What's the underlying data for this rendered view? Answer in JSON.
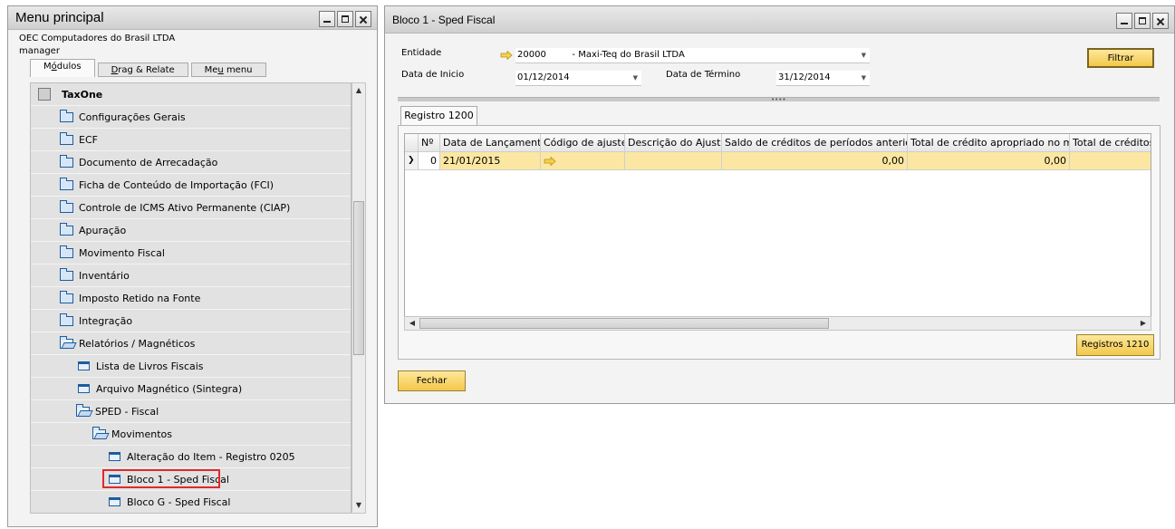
{
  "menu": {
    "title": "Menu principal",
    "company": "OEC Computadores do Brasil LTDA",
    "user": "manager",
    "tabs": [
      {
        "pre": "M",
        "ul": "ó",
        "post": "dulos"
      },
      {
        "pre": "",
        "ul": "D",
        "post": "rag & Relate"
      },
      {
        "pre": "Me",
        "ul": "u",
        "post": " menu"
      }
    ],
    "tree": [
      {
        "label": "TaxOne",
        "icon": "taxone-module-icon"
      },
      {
        "label": "Configurações Gerais",
        "icon": "folder-icon"
      },
      {
        "label": "ECF",
        "icon": "folder-icon"
      },
      {
        "label": "Documento de Arrecadação",
        "icon": "folder-icon"
      },
      {
        "label": "Ficha de Conteúdo de Importação (FCI)",
        "icon": "folder-icon"
      },
      {
        "label": "Controle de ICMS Ativo Permanente (CIAP)",
        "icon": "folder-icon"
      },
      {
        "label": "Apuração",
        "icon": "folder-icon"
      },
      {
        "label": "Movimento Fiscal",
        "icon": "folder-icon"
      },
      {
        "label": "Inventário",
        "icon": "folder-icon"
      },
      {
        "label": "Imposto Retido na Fonte",
        "icon": "folder-icon"
      },
      {
        "label": "Integração",
        "icon": "folder-icon"
      },
      {
        "label": "Relatórios / Magnéticos",
        "icon": "folder-open-icon"
      },
      {
        "label": "Lista de Livros Fiscais",
        "icon": "form-icon"
      },
      {
        "label": "Arquivo Magnético (Sintegra)",
        "icon": "form-icon"
      },
      {
        "label": "SPED - Fiscal",
        "icon": "folder-open-icon"
      },
      {
        "label": "Movimentos",
        "icon": "folder-open-icon"
      },
      {
        "label": "Alteração do Item - Registro 0205",
        "icon": "form-icon"
      },
      {
        "label": "Bloco 1 - Sped Fiscal",
        "icon": "form-icon"
      },
      {
        "label": "Bloco G - Sped Fiscal",
        "icon": "form-icon"
      }
    ]
  },
  "bloco": {
    "title": "Bloco 1 - Sped Fiscal",
    "entidade_label": "Entidade",
    "entidade_value": "20000         - Maxi-Teq do Brasil LTDA",
    "data_inicio_label": "Data de Inicio",
    "data_inicio_value": "01/12/2014",
    "data_termino_label": "Data de Término",
    "data_termino_value": "31/12/2014",
    "filtrar_label": "Filtrar",
    "tab_label": "Registro 1200",
    "columns": [
      "Nº",
      "Data de Lançamento",
      "Código de ajuste",
      "Descrição do Ajuste",
      "Saldo de créditos de períodos anteriores",
      "Total de crédito apropriado no mês",
      "Total de créditos u"
    ],
    "row": {
      "num": "0",
      "data": "21/01/2015",
      "codigo": "",
      "descricao": "",
      "saldo": "0,00",
      "total_apropriado": "0,00",
      "total_creditos": ""
    },
    "registros_button": "Registros 1210",
    "fechar_button": "Fechar"
  }
}
